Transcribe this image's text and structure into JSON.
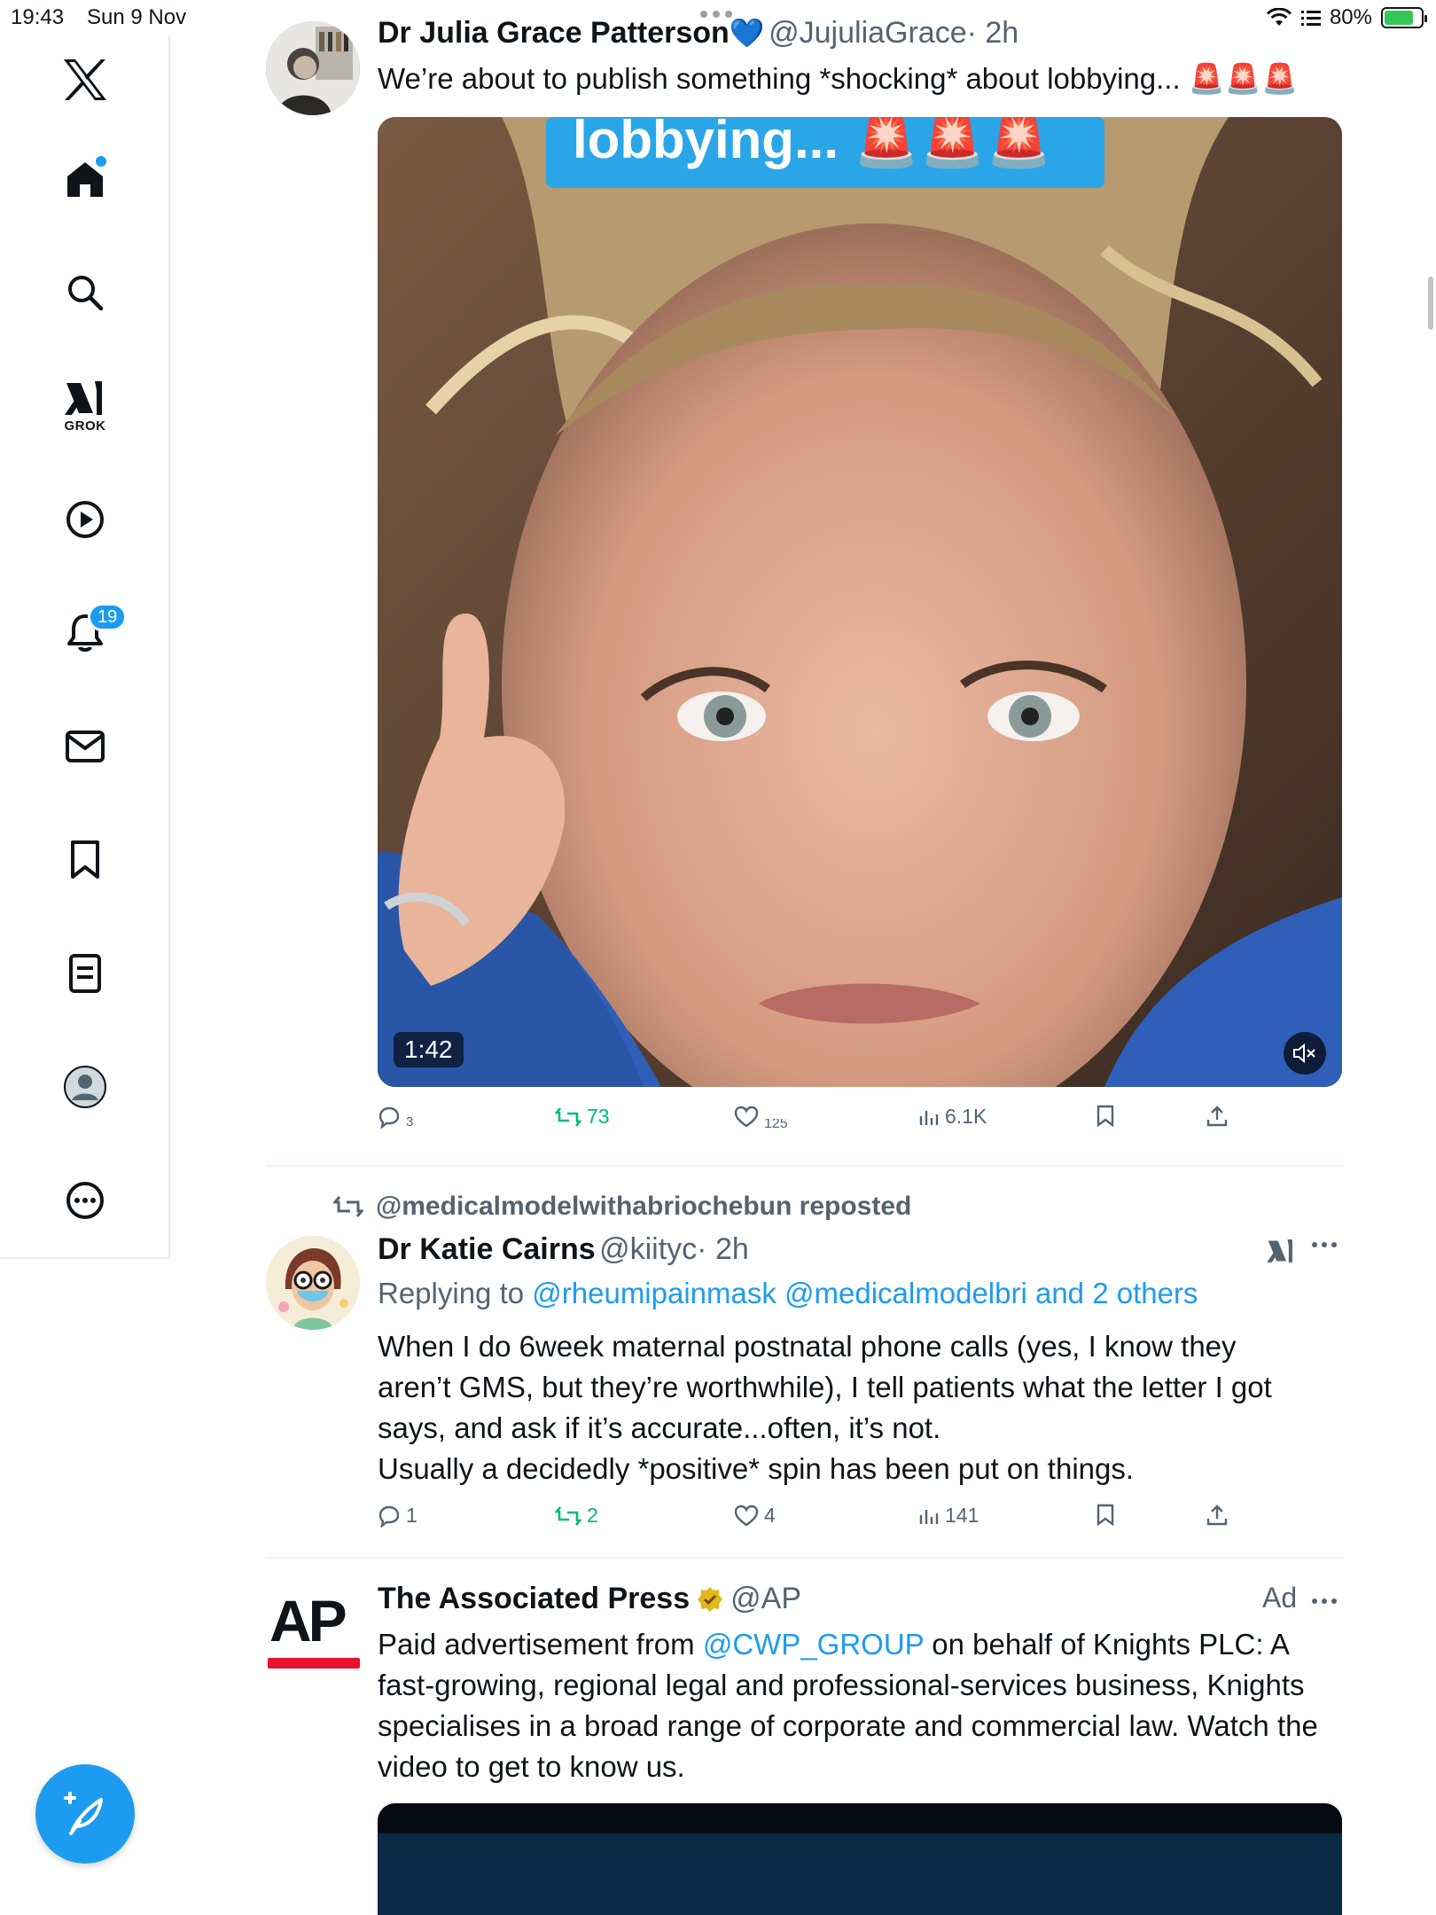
{
  "status_bar": {
    "time": "19:43",
    "date": "Sun 9 Nov",
    "battery": "80%",
    "battery_level": 0.8
  },
  "sidebar": {
    "grok_label": "GROK",
    "notifications_badge": "19",
    "items": [
      "x-logo",
      "home",
      "search",
      "grok",
      "video",
      "notifications",
      "messages",
      "bookmarks",
      "lists",
      "profile",
      "more"
    ]
  },
  "posts": [
    {
      "name": "Dr Julia Grace Patterson",
      "name_emoji": "💙",
      "handle": "@JujuliaGrace",
      "time": "· 2h",
      "text": "We’re about to publish something *shocking* about lobbying... 🚨🚨🚨",
      "video": {
        "caption": "lobbying... 🚨🚨🚨",
        "duration": "1:42"
      },
      "replies": "3",
      "reposts": "73",
      "likes": "125",
      "views": "6.1K"
    },
    {
      "reposted_by": "@medicalmodelwithabriochebun reposted",
      "name": "Dr Katie Cairns",
      "handle": "@kiityc",
      "time": "· 2h",
      "replying_prefix": "Replying to ",
      "replying_to": "@rheumipainmask @medicalmodelbri and 2 others",
      "text_lines": [
        "When I do 6week maternal postnatal phone calls (yes, I know they",
        "aren’t GMS, but they’re worthwhile), I tell patients what the letter I got",
        "says, and ask if it’s accurate...often, it’s not.",
        "Usually a decidedly *positive* spin has been put on things."
      ],
      "replies": "1",
      "reposts": "2",
      "likes": "4",
      "views": "141"
    },
    {
      "name": "The Associated Press",
      "handle": "@AP",
      "ad_label": "Ad",
      "logo_text": "AP",
      "text_pre": "Paid advertisement from ",
      "text_link": "@CWP_GROUP",
      "text_post": " on behalf of Knights PLC: A fast-growing, regional legal and professional-services business, Knights specialises in a broad range of corporate and commercial law. Watch the video to get to know us."
    }
  ],
  "colors": {
    "accent": "#1d9bf0",
    "repost": "#00ba7c",
    "secondary": "#536471",
    "verified_gold": "#e2b719"
  }
}
